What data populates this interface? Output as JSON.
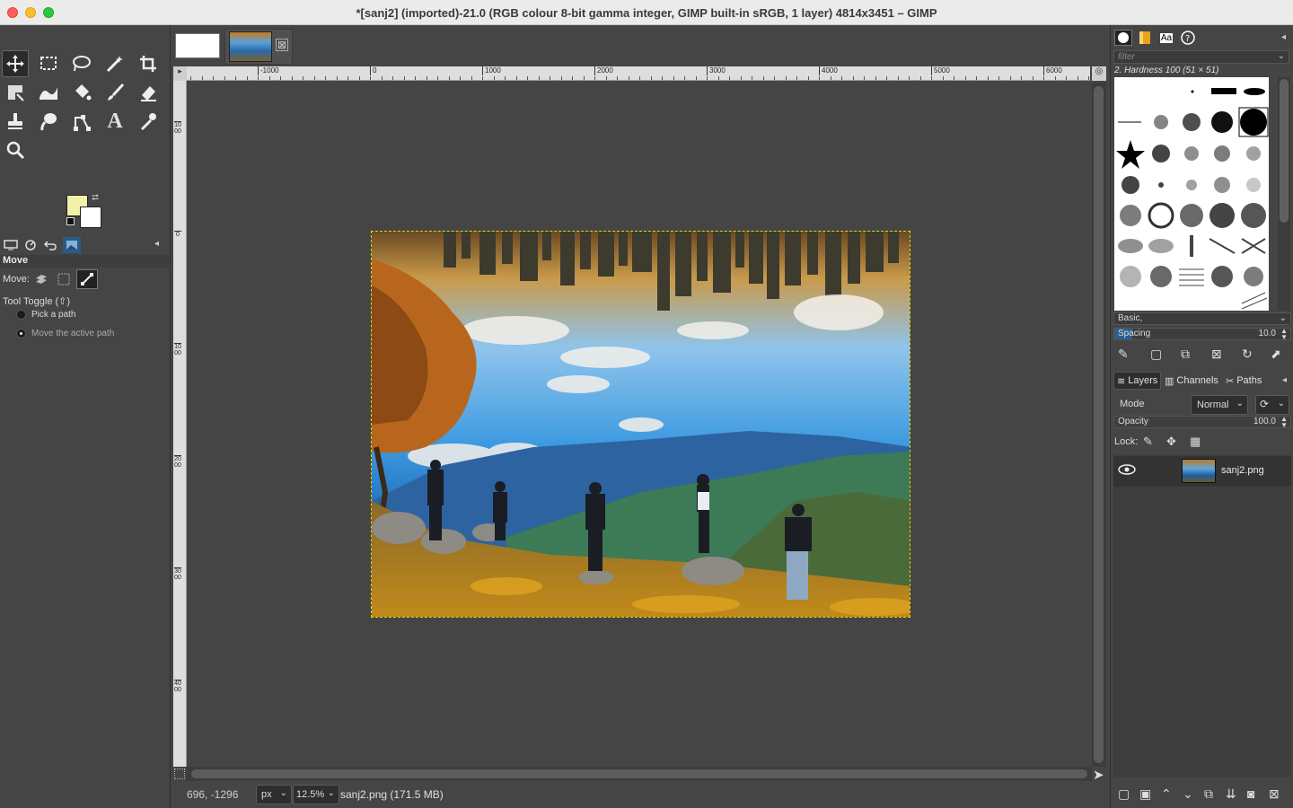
{
  "window": {
    "title": "*[sanj2] (imported)-21.0 (RGB colour 8-bit gamma integer, GIMP built-in sRGB, 1 layer) 4814x3451 – GIMP"
  },
  "toolbox": {
    "tools": [
      {
        "name": "move-tool",
        "icon": "✥",
        "active": true
      },
      {
        "name": "rect-select-tool",
        "icon": "⬚"
      },
      {
        "name": "free-select-tool",
        "icon": "ℓ"
      },
      {
        "name": "fuzzy-select-tool",
        "icon": "⚡"
      },
      {
        "name": "crop-tool",
        "icon": "⌗"
      },
      {
        "name": "unified-transform-tool",
        "icon": "⤡"
      },
      {
        "name": "warp-transform-tool",
        "icon": "≋"
      },
      {
        "name": "bucket-fill-tool",
        "icon": "⛾"
      },
      {
        "name": "paintbrush-tool",
        "icon": "✎"
      },
      {
        "name": "eraser-tool",
        "icon": "⌫"
      },
      {
        "name": "clone-tool",
        "icon": "⊥"
      },
      {
        "name": "smudge-tool",
        "icon": "☝"
      },
      {
        "name": "paths-tool",
        "icon": "⤴"
      },
      {
        "name": "text-tool",
        "icon": "A"
      },
      {
        "name": "color-picker-tool",
        "icon": "⁄"
      },
      {
        "name": "zoom-tool",
        "icon": "⚲"
      }
    ],
    "colors": {
      "foreground": "#f3f0a8",
      "background": "#ffffff"
    }
  },
  "tool_options": {
    "header": "Move",
    "move_label": "Move:",
    "tool_toggle": "Tool Toggle  (⇧)",
    "options": [
      "Pick a path",
      "Move the active path"
    ],
    "selected_option": 1
  },
  "image_tabs": {
    "close_glyph": "⊠"
  },
  "rulers": {
    "top": [
      "-1000",
      "0",
      "1000",
      "2000",
      "3000",
      "4000",
      "5000",
      "6000"
    ],
    "left": [
      "1000",
      "0",
      "1000",
      "2000",
      "3000",
      "4000"
    ]
  },
  "status": {
    "coords": "696, -1296",
    "unit": "px",
    "zoom": "12.5%",
    "message": "sanj2.png (171.5 MB)"
  },
  "brushes": {
    "filter_placeholder": "filter",
    "selected_brush": "2. Hardness 100 (51 × 51)",
    "tag": "Basic,",
    "spacing_label": "Spacing",
    "spacing_value": "10.0"
  },
  "layers_panel": {
    "tabs": [
      "Layers",
      "Channels",
      "Paths"
    ],
    "mode_label": "Mode",
    "mode_value": "Normal",
    "opacity_label": "Opacity",
    "opacity_value": "100.0",
    "lock_label": "Lock:",
    "layers": [
      {
        "name": "sanj2.png",
        "visible": true
      }
    ]
  },
  "accent": "#2c5a86"
}
